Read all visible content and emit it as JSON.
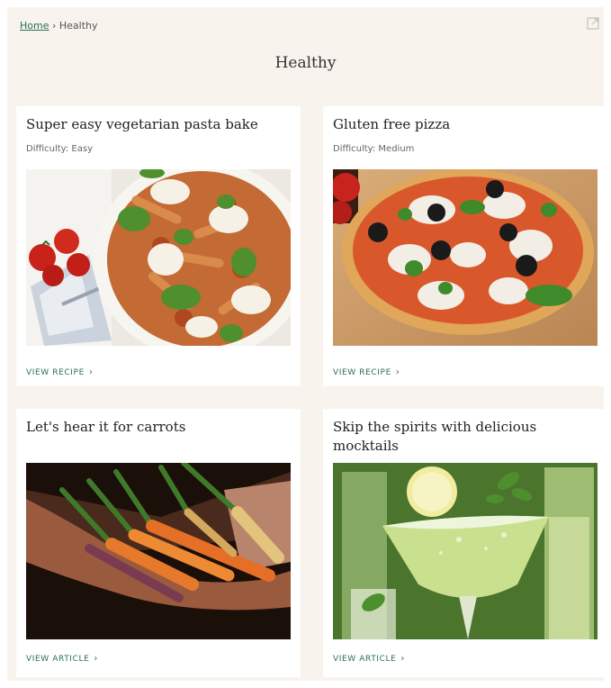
{
  "breadcrumb": {
    "home": "Home",
    "separator": "›",
    "current": "Healthy"
  },
  "page_title": "Healthy",
  "cards": [
    {
      "title": "Super easy vegetarian pasta bake",
      "meta": "Difficulty: Easy",
      "link": "View recipe",
      "image": "pasta-bake-image"
    },
    {
      "title": "Gluten free pizza",
      "meta": "Difficulty: Medium",
      "link": "View recipe",
      "image": "pizza-image"
    },
    {
      "title": "Let's hear it for carrots",
      "meta": "",
      "link": "View article",
      "image": "carrots-image"
    },
    {
      "title": "Skip the spirits with delicious mocktails",
      "meta": "",
      "link": "View article",
      "image": "mocktail-image"
    }
  ],
  "colors": {
    "page_background": "#f8f3ed",
    "card_background": "#ffffff",
    "link": "#2a6f58"
  }
}
